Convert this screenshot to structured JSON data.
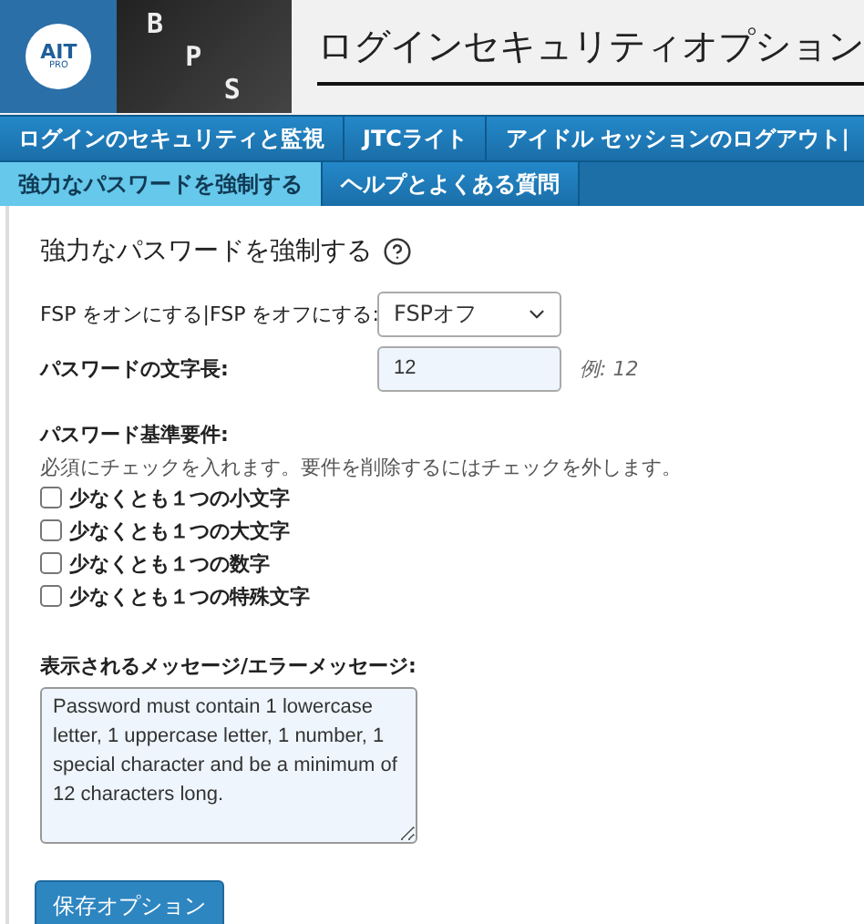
{
  "logo": {
    "badge": "AIT",
    "badge_sub": "PRO",
    "letters": [
      "B",
      "P",
      "S"
    ]
  },
  "page_title": "ログインセキュリティオプション",
  "main_tabs": [
    {
      "label": "ログインのセキュリティと監視",
      "selected": false
    },
    {
      "label": "JTCライト",
      "selected": false
    },
    {
      "label": "アイドル セッションのログアウト|",
      "selected": false
    }
  ],
  "sub_tabs": [
    {
      "label": "強力なパスワードを強制する",
      "selected": true
    },
    {
      "label": "ヘルプとよくある質問",
      "selected": false
    }
  ],
  "section_title": "強力なパスワードを強制する",
  "fsp": {
    "label": "FSP をオンにする|FSP をオフにする:",
    "value": "FSPオフ"
  },
  "length": {
    "label": "パスワードの文字長:",
    "value": "12",
    "example": "例: 12"
  },
  "requirements": {
    "title": "パスワード基準要件:",
    "hint": "必須にチェックを入れます。要件を削除するにはチェックを外します。",
    "items": [
      {
        "label": "少なくとも１つの小文字",
        "checked": false
      },
      {
        "label": "少なくとも１つの大文字",
        "checked": false
      },
      {
        "label": "少なくとも１つの数字",
        "checked": false
      },
      {
        "label": "少なくとも１つの特殊文字",
        "checked": false
      }
    ]
  },
  "message": {
    "label": "表示されるメッセージ/エラーメッセージ:",
    "value": "Password must contain 1 lowercase letter, 1 uppercase letter, 1 number, 1 special character and be a minimum of 12 characters long."
  },
  "save_button": "保存オプション"
}
